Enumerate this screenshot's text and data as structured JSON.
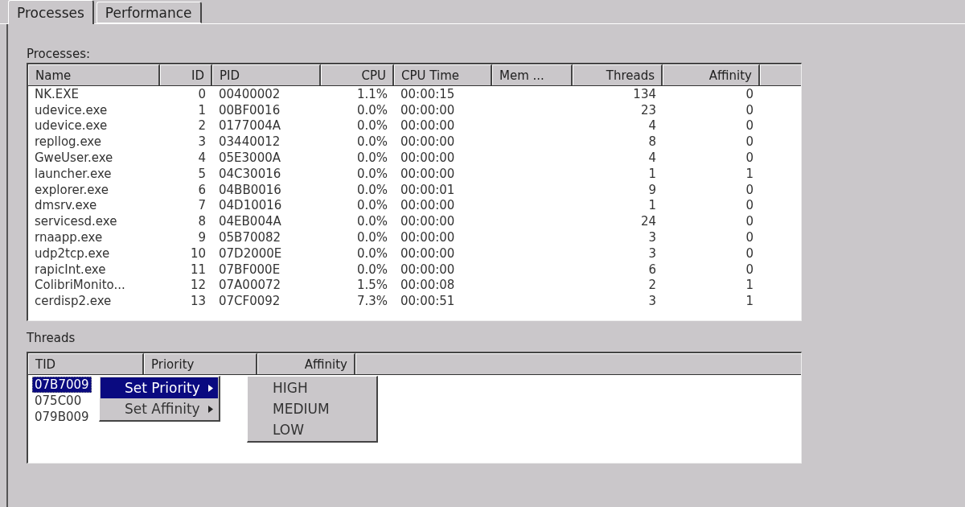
{
  "tabs": [
    {
      "label": "Processes",
      "selected": true
    },
    {
      "label": "Performance",
      "selected": false
    }
  ],
  "processes": {
    "label": "Processes:",
    "columns": [
      "Name",
      "ID",
      "PID",
      "CPU",
      "CPU Time",
      "Mem ...",
      "Threads",
      "Affinity"
    ],
    "rows": [
      {
        "selected": false,
        "cells": [
          "NK.EXE",
          "0",
          "00400002",
          "1.1%",
          "00:00:15",
          "",
          "134",
          "0"
        ]
      },
      {
        "selected": false,
        "cells": [
          "udevice.exe",
          "1",
          "00BF0016",
          "0.0%",
          "00:00:00",
          "",
          "23",
          "0"
        ]
      },
      {
        "selected": false,
        "cells": [
          "udevice.exe",
          "2",
          "0177004A",
          "0.0%",
          "00:00:00",
          "",
          "4",
          "0"
        ]
      },
      {
        "selected": false,
        "cells": [
          "repllog.exe",
          "3",
          "03440012",
          "0.0%",
          "00:00:00",
          "",
          "8",
          "0"
        ]
      },
      {
        "selected": false,
        "cells": [
          "GweUser.exe",
          "4",
          "05E3000A",
          "0.0%",
          "00:00:00",
          "",
          "4",
          "0"
        ]
      },
      {
        "selected": false,
        "cells": [
          "launcher.exe",
          "5",
          "04C30016",
          "0.0%",
          "00:00:00",
          "",
          "1",
          "1"
        ]
      },
      {
        "selected": false,
        "cells": [
          "explorer.exe",
          "6",
          "04BB0016",
          "0.0%",
          "00:00:01",
          "",
          "9",
          "0"
        ]
      },
      {
        "selected": false,
        "cells": [
          "dmsrv.exe",
          "7",
          "04D10016",
          "0.0%",
          "00:00:00",
          "",
          "1",
          "0"
        ]
      },
      {
        "selected": false,
        "cells": [
          "servicesd.exe",
          "8",
          "04EB004A",
          "0.0%",
          "00:00:00",
          "",
          "24",
          "0"
        ]
      },
      {
        "selected": false,
        "cells": [
          "rnaapp.exe",
          "9",
          "05B70082",
          "0.0%",
          "00:00:00",
          "",
          "3",
          "0"
        ]
      },
      {
        "selected": false,
        "cells": [
          "udp2tcp.exe",
          "10",
          "07D2000E",
          "0.0%",
          "00:00:00",
          "",
          "3",
          "0"
        ]
      },
      {
        "selected": false,
        "cells": [
          "rapicInt.exe",
          "11",
          "07BF000E",
          "0.0%",
          "00:00:00",
          "",
          "6",
          "0"
        ]
      },
      {
        "selected": false,
        "cells": [
          "ColibriMonito...",
          "12",
          "07A00072",
          "1.5%",
          "00:00:08",
          "",
          "2",
          "1"
        ]
      },
      {
        "selected": false,
        "cells": [
          "cerdisp2.exe",
          "13",
          "07CF0092",
          "7.3%",
          "00:00:51",
          "",
          "3",
          "1"
        ]
      }
    ]
  },
  "threads": {
    "label": "Threads",
    "columns": [
      "TID",
      "Priority",
      "Affinity"
    ],
    "rows": [
      {
        "tid": "07B7009",
        "selected": true
      },
      {
        "tid": "075C00",
        "selected": false
      },
      {
        "tid": "079B009",
        "selected": false
      }
    ]
  },
  "context_menu": {
    "items": [
      {
        "label": "Set Priority",
        "selected": true,
        "submenu": true
      },
      {
        "label": "Set Affinity",
        "selected": false,
        "submenu": true
      }
    ]
  },
  "submenu": {
    "items": [
      {
        "label": "HIGH",
        "selected": false
      },
      {
        "label": "MEDIUM",
        "selected": false
      },
      {
        "label": "LOW",
        "selected": false
      }
    ]
  }
}
